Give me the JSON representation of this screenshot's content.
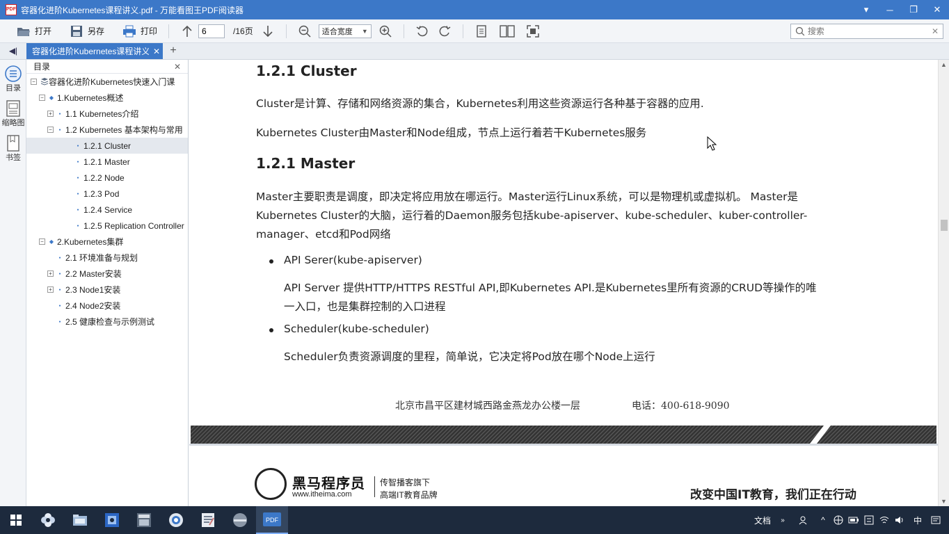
{
  "window": {
    "title": "容器化进阶Kubernetes课程讲义.pdf - 万能看图王PDF阅读器",
    "app_icon_text": "PDF"
  },
  "toolbar": {
    "open_label": "打开",
    "saveas_label": "另存",
    "print_label": "打印",
    "current_page": "6",
    "total_pages": "/16页",
    "zoom_mode": "适合宽度",
    "search_placeholder": "搜索"
  },
  "tab": {
    "label": "容器化进阶Kubernetes课程讲义"
  },
  "leftstrip": {
    "toc_label": "目录",
    "thumbs_label": "缩略图",
    "bookmarks_label": "书签"
  },
  "toc": {
    "header": "目录",
    "items": [
      {
        "label": "容器化进阶Kubernetes快速入门课",
        "level": 0,
        "expander": "−",
        "kind": "book"
      },
      {
        "label": "1.Kubernetes概述",
        "level": 1,
        "expander": "−",
        "kind": "diamond"
      },
      {
        "label": "1.1 Kubernetes介绍",
        "level": 2,
        "expander": "+",
        "kind": "dot"
      },
      {
        "label": "1.2 Kubernetes 基本架构与常用",
        "level": 2,
        "expander": "−",
        "kind": "dot"
      },
      {
        "label": "1.2.1 Cluster",
        "level": 3,
        "expander": "",
        "kind": "dot",
        "selected": true
      },
      {
        "label": "1.2.1 Master",
        "level": 3,
        "expander": "",
        "kind": "dot"
      },
      {
        "label": "1.2.2 Node",
        "level": 3,
        "expander": "",
        "kind": "dot"
      },
      {
        "label": "1.2.3 Pod",
        "level": 3,
        "expander": "",
        "kind": "dot"
      },
      {
        "label": "1.2.4 Service",
        "level": 3,
        "expander": "",
        "kind": "dot"
      },
      {
        "label": "1.2.5 Replication Controller",
        "level": 3,
        "expander": "",
        "kind": "dot"
      },
      {
        "label": "2.Kubernetes集群",
        "level": 1,
        "expander": "−",
        "kind": "diamond"
      },
      {
        "label": "2.1 环境准备与规划",
        "level": 2,
        "expander": "",
        "kind": "dot"
      },
      {
        "label": "2.2 Master安装",
        "level": 2,
        "expander": "+",
        "kind": "dot"
      },
      {
        "label": "2.3 Node1安装",
        "level": 2,
        "expander": "+",
        "kind": "dot"
      },
      {
        "label": "2.4 Node2安装",
        "level": 2,
        "expander": "",
        "kind": "dot"
      },
      {
        "label": "2.5 健康检查与示例测试",
        "level": 2,
        "expander": "",
        "kind": "dot"
      }
    ]
  },
  "document": {
    "heading_cluster": "1.2.1 Cluster",
    "cluster_p1": "Cluster是计算、存储和网络资源的集合，Kubernetes利用这些资源运行各种基于容器的应用.",
    "cluster_p2": "Kubernetes Cluster由Master和Node组成，节点上运行着若干Kubernetes服务",
    "heading_master": "1.2.1 Master",
    "master_p1_l1": "Master主要职责是调度，即决定将应用放在哪运行。Master运行Linux系统，可以是物理机或虚拟机。 Master是",
    "master_p1_l2": "Kubernetes Cluster的大脑，运行着的Daemon服务包括kube-apiserver、kube-scheduler、kuber-controller-",
    "master_p1_l3": "manager、etcd和Pod网络",
    "bullet1_title": "API Serer(kube-apiserver)",
    "bullet1_desc_l1": "API Server 提供HTTP/HTTPS RESTful API,即Kubernetes API.是Kubernetes里所有资源的CRUD等操作的唯",
    "bullet1_desc_l2": "一入口，也是集群控制的入口进程",
    "bullet2_title": "Scheduler(kube-scheduler)",
    "bullet2_desc": "Scheduler负责资源调度的里程，简单说，它决定将Pod放在哪个Node上运行",
    "footer_address": "北京市昌平区建材城西路金燕龙办公楼一层",
    "footer_phone": "电话：400-618-9090"
  },
  "page2": {
    "logo_name": "黑马程序员",
    "logo_url": "www.itheima.com",
    "logo_tag1": "传智播客旗下",
    "logo_tag2": "高端IT教育品牌",
    "slogan": "改变中国IT教育，我们正在行动"
  },
  "taskbar": {
    "apps": [
      "start-icon",
      "pinwheel-icon",
      "file-explorer-icon",
      "screen-recorder-icon",
      "image-viewer-icon",
      "browser-icon",
      "text-editor-icon",
      "media-player-icon",
      "pdf-reader-icon"
    ],
    "active_app_label": "PDF",
    "tray_docs_label": "文档",
    "tray_lang": "中"
  },
  "colors": {
    "titlebar": "#3c78c8",
    "taskbar": "#1d2a3d",
    "band": "#3a3a3a"
  }
}
